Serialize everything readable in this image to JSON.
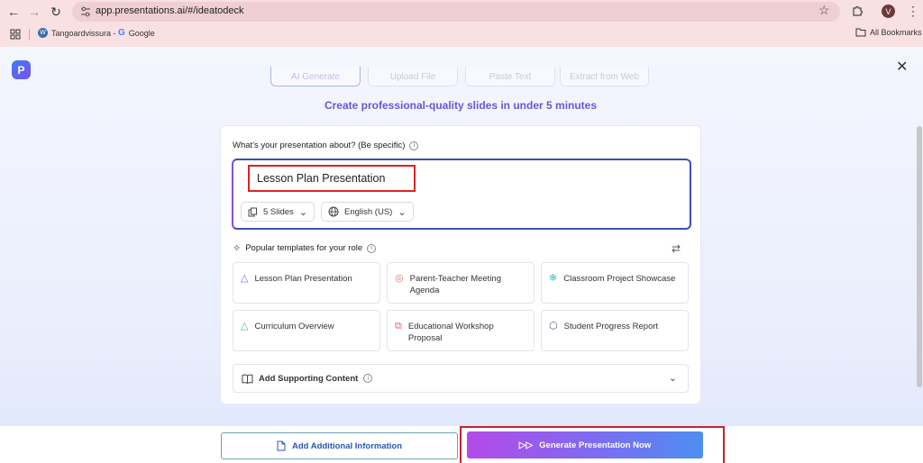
{
  "browser": {
    "url": "app.presentations.ai/#/ideatodeck",
    "profile_initial": "V",
    "bookmarks": [
      {
        "label": "Tangoardvissura -",
        "icon": "wordpress-icon"
      },
      {
        "label": "Google",
        "icon": "google-icon"
      }
    ],
    "all_bookmarks_label": "All Bookmarks"
  },
  "app": {
    "logo_letter": "P",
    "tabs": [
      {
        "label": "AI Generate",
        "active": true
      },
      {
        "label": "Upload File",
        "active": false
      },
      {
        "label": "Paste Text",
        "active": false
      },
      {
        "label": "Extract from Web",
        "active": false
      }
    ],
    "tagline": "Create professional-quality slides in under 5 minutes",
    "question_label": "What's your presentation about? (Be specific)",
    "topic_value": "Lesson Plan Presentation",
    "slides_option": "5 Slides",
    "language_option": "English (US)",
    "templates_heading": "Popular templates for your role",
    "templates": [
      {
        "label": "Lesson Plan Presentation",
        "icon": "triangle-icon",
        "color": "#8a6be0"
      },
      {
        "label": "Parent-Teacher Meeting Agenda",
        "icon": "rings-icon",
        "color": "#e0786a"
      },
      {
        "label": "Classroom Project Showcase",
        "icon": "snowflake-icon",
        "color": "#33b6c9"
      },
      {
        "label": "Curriculum Overview",
        "icon": "triangle-icon",
        "color": "#4cb873"
      },
      {
        "label": "Educational Workshop Proposal",
        "icon": "squares-icon",
        "color": "#e0607a"
      },
      {
        "label": "Student Progress Report",
        "icon": "cube-icon",
        "color": "#5a5a8a"
      }
    ],
    "supporting_content_label": "Add Supporting Content",
    "add_info_label": "Add Additional Information",
    "generate_label": "Generate Presentation Now"
  },
  "colors": {
    "accent": "#6a55d9",
    "highlight": "#d22222",
    "chrome": "#f9e0e3"
  }
}
